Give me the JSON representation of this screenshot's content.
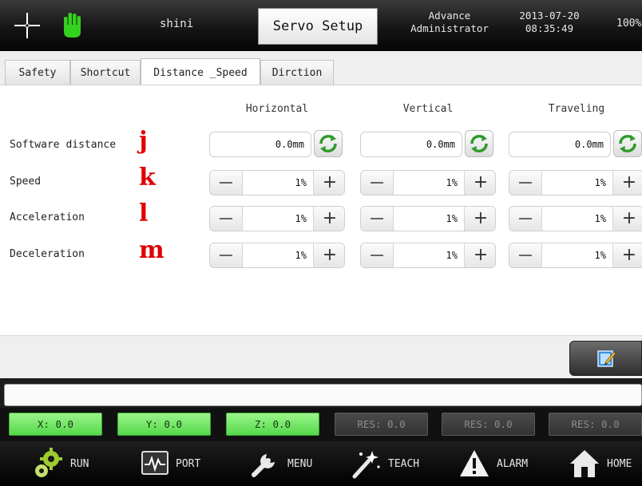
{
  "header": {
    "user": "shini",
    "title": "Servo Setup",
    "level_line1": "Advance",
    "level_line2": "Administrator",
    "date": "2013-07-20",
    "time": "08:35:49",
    "percent": "100%",
    "icons": [
      "origin-crosshair-icon",
      "manual-hand-icon"
    ]
  },
  "tabs": [
    {
      "label": "Safety",
      "active": false
    },
    {
      "label": "Shortcut",
      "active": false
    },
    {
      "label": "Distance _Speed",
      "active": true
    },
    {
      "label": "Dirction",
      "active": false
    }
  ],
  "columns": [
    "Horizontal",
    "Vertical",
    "Traveling"
  ],
  "rows": [
    {
      "label": "Software distance",
      "marker": "j",
      "values": [
        "0.0mm",
        "0.0mm",
        "0.0mm"
      ]
    },
    {
      "label": "Speed",
      "marker": "k",
      "values": [
        "1%",
        "1%",
        "1%"
      ]
    },
    {
      "label": "Acceleration",
      "marker": "l",
      "values": [
        "1%",
        "1%",
        "1%"
      ]
    },
    {
      "label": "Deceleration",
      "marker": "m",
      "values": [
        "1%",
        "1%",
        "1%"
      ]
    }
  ],
  "message": "",
  "coords": [
    {
      "label": "X: 0.0",
      "enabled": true
    },
    {
      "label": "Y: 0.0",
      "enabled": true
    },
    {
      "label": "Z: 0.0",
      "enabled": true
    },
    {
      "label": "RES: 0.0",
      "enabled": false
    },
    {
      "label": "RES: 0.0",
      "enabled": false
    },
    {
      "label": "RES: 0.0",
      "enabled": false
    }
  ],
  "nav": [
    {
      "label": "RUN",
      "icon": "gears-icon"
    },
    {
      "label": "PORT",
      "icon": "monitor-wave-icon"
    },
    {
      "label": "MENU",
      "icon": "wrench-icon"
    },
    {
      "label": "TEACH",
      "icon": "magic-wand-icon"
    },
    {
      "label": "ALARM",
      "icon": "warning-triangle-icon"
    },
    {
      "label": "HOME",
      "icon": "home-icon"
    }
  ],
  "colors": {
    "marker": "#e00000",
    "coord_active": "#55d84a",
    "refresh_green": "#2e9b2a"
  }
}
